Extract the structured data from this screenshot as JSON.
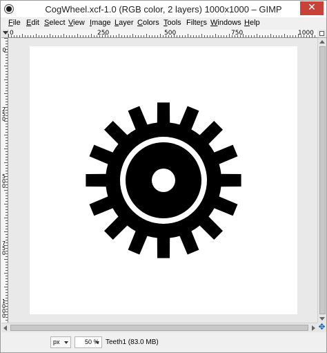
{
  "window": {
    "title": "CogWheel.xcf-1.0 (RGB color, 2 layers) 1000x1000 – GIMP",
    "close_glyph": "✕"
  },
  "menubar": {
    "items": [
      {
        "label": "File",
        "u": "F",
        "rest": "ile"
      },
      {
        "label": "Edit",
        "u": "E",
        "rest": "dit"
      },
      {
        "label": "Select",
        "u": "S",
        "rest": "elect"
      },
      {
        "label": "View",
        "u": "V",
        "rest": "iew"
      },
      {
        "label": "Image",
        "u": "I",
        "rest": "mage"
      },
      {
        "label": "Layer",
        "u": "L",
        "rest": "ayer"
      },
      {
        "label": "Colors",
        "u": "C",
        "rest": "olors"
      },
      {
        "label": "Tools",
        "u": "T",
        "rest": "ools"
      },
      {
        "label": "Filters",
        "pre": "Filte",
        "u": "r",
        "rest": "s"
      },
      {
        "label": "Windows",
        "u": "W",
        "rest": "indows"
      },
      {
        "label": "Help",
        "u": "H",
        "rest": "elp"
      }
    ]
  },
  "rulers": {
    "horizontal_labels": [
      "0",
      "250",
      "500",
      "750",
      "1000"
    ],
    "vertical_labels": [
      "0",
      "250",
      "500",
      "750",
      "1000"
    ]
  },
  "statusbar": {
    "unit": "px",
    "zoom": "50 %",
    "layer_info": "Teeth1 (83.0 MB)"
  },
  "icons": {
    "navigate": "✥"
  },
  "image": {
    "background": "#ffffff",
    "foreground": "#000000"
  }
}
